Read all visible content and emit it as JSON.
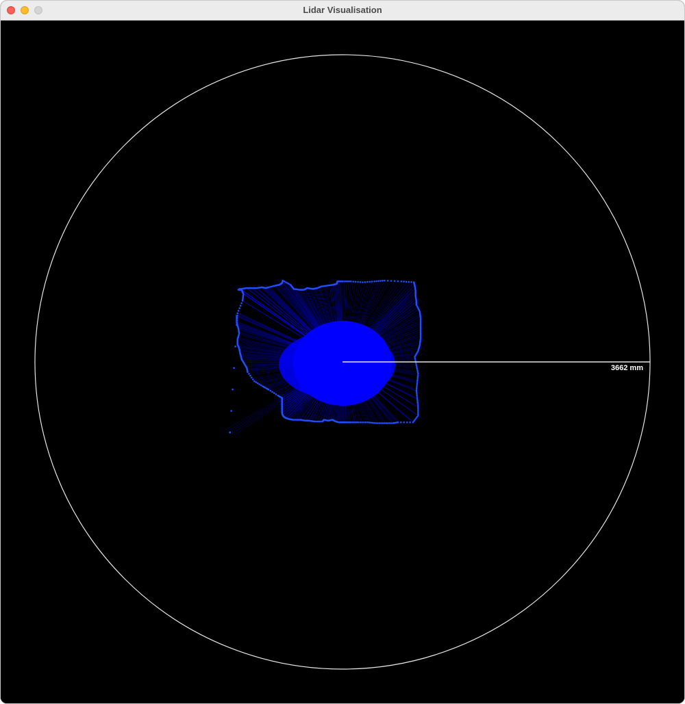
{
  "window": {
    "title": "Lidar Visualisation"
  },
  "plot": {
    "range_label": "3662 mm",
    "range_mm": 3662,
    "colors": {
      "background": "#000000",
      "circle": "#e6e6e6",
      "points": "#1f4fff",
      "rays": "#0000ff"
    }
  },
  "chart_data": {
    "type": "scatter",
    "max_range_mm": 3662,
    "series": [
      {
        "x_mm": [
          -1260,
          -1260,
          -1240,
          -1230,
          -1250,
          -1250,
          -1230,
          -1220,
          -1210,
          -1200,
          -1170,
          -1140,
          -1130,
          -1050,
          -950,
          -880,
          -770,
          -720,
          -720,
          -720,
          -720,
          -720,
          -720,
          -720,
          -710,
          -690,
          -670,
          -640,
          -590,
          -500,
          -440,
          -400,
          -330,
          -240,
          -220,
          -170,
          -120,
          -80,
          -40,
          0,
          40,
          100,
          190,
          300,
          400,
          500,
          600,
          660,
          840,
          900,
          900,
          890,
          880,
          890,
          900,
          880,
          860,
          900,
          920,
          930,
          930,
          930,
          930,
          920,
          880,
          880,
          870,
          870,
          860,
          850,
          700,
          500,
          380,
          240,
          100,
          0,
          -60,
          -70,
          -110,
          -180,
          -250,
          -300,
          -350,
          -420,
          -460,
          -510,
          -580,
          -620,
          -710,
          -720,
          -750,
          -800,
          -880,
          -910,
          -960,
          -1020,
          -1080,
          -1140,
          -1220,
          -1240,
          -1200,
          -1180,
          -1190,
          -1250,
          -1260,
          -1340
        ],
        "y_mm": [
          550,
          470,
          400,
          340,
          270,
          210,
          160,
          110,
          70,
          30,
          -20,
          -70,
          -120,
          -230,
          -290,
          -330,
          -400,
          -430,
          -460,
          -490,
          -520,
          -550,
          -580,
          -610,
          -640,
          -660,
          -670,
          -680,
          -690,
          -690,
          -700,
          -700,
          -710,
          -710,
          -690,
          -700,
          -690,
          -710,
          -720,
          -720,
          -720,
          -720,
          -720,
          -720,
          -730,
          -730,
          -730,
          -720,
          -720,
          -640,
          -540,
          -440,
          -340,
          -240,
          -140,
          -40,
          60,
          130,
          200,
          280,
          360,
          440,
          520,
          600,
          680,
          720,
          790,
          850,
          910,
          950,
          960,
          970,
          960,
          950,
          960,
          960,
          960,
          930,
          920,
          910,
          900,
          880,
          870,
          880,
          860,
          860,
          870,
          920,
          970,
          940,
          920,
          910,
          890,
          880,
          890,
          880,
          880,
          880,
          870,
          860,
          860,
          810,
          730,
          580,
          440,
          -840
        ],
        "note": ""
      }
    ]
  }
}
